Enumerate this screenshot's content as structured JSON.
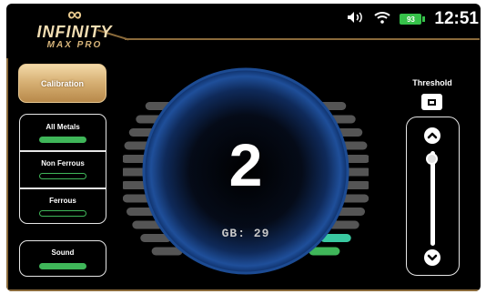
{
  "brand": {
    "symbol": "∞",
    "name": "INFINITY",
    "subtitle": "MAX PRO"
  },
  "status_bar": {
    "battery_level": "93",
    "time": "12:51"
  },
  "left_panel": {
    "calibration_label": "Calibration",
    "modes": [
      {
        "label": "All Metals",
        "active": true
      },
      {
        "label": "Non Ferrous",
        "active": false
      },
      {
        "label": "Ferrous",
        "active": false
      }
    ],
    "sound_label": "Sound",
    "sound_on": true
  },
  "display": {
    "value": "2",
    "gb_label": "GB: 29"
  },
  "threshold": {
    "label": "Threshold",
    "value": "0",
    "level": 0.08
  },
  "colors": {
    "accent_gold": "#d8b276",
    "indicator_green": "#3fb659",
    "dial_blue": "#1f4f9a",
    "bar_teal": "#39c8a0",
    "bar_green": "#3fb659"
  },
  "meter": {
    "left_bars": 12,
    "right_bars": 12,
    "active_right": 2
  }
}
